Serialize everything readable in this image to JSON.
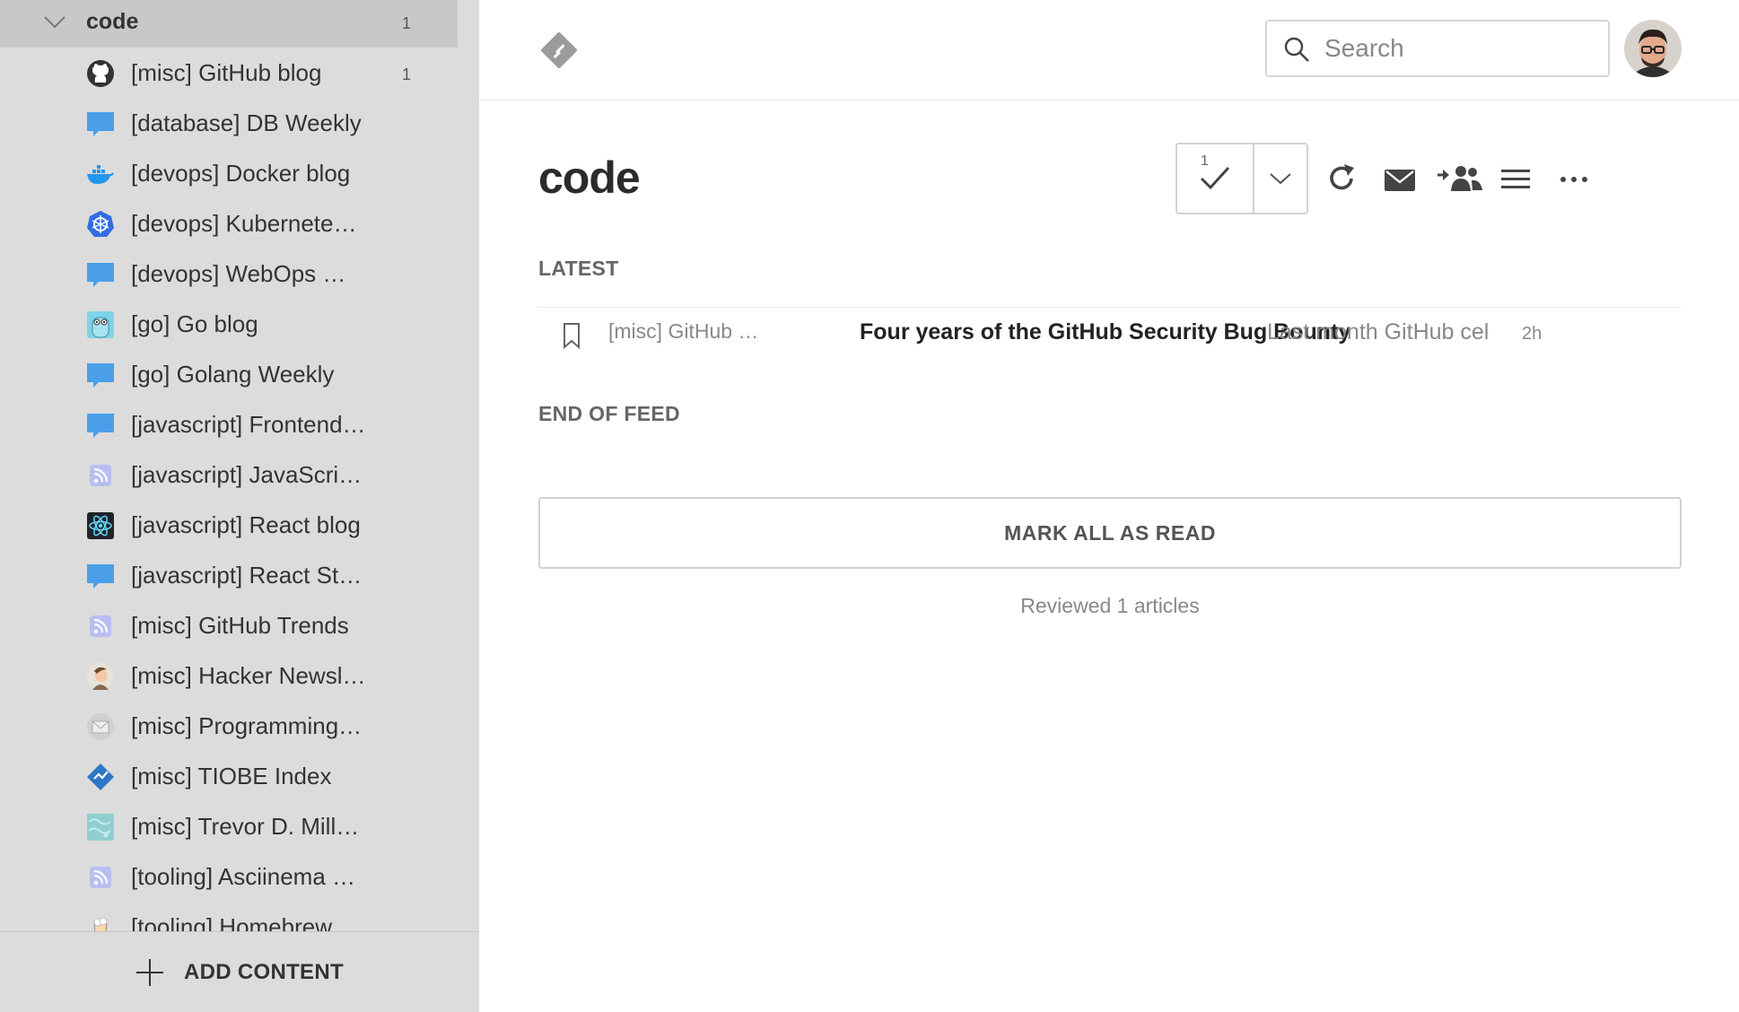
{
  "sidebar": {
    "group": {
      "name": "code",
      "count": "1"
    },
    "feeds": [
      {
        "label": "[misc] GitHub blog",
        "count": "1",
        "icon": "github-icon"
      },
      {
        "label": "[database] DB Weekly",
        "count": "",
        "icon": "chat-bubble-icon"
      },
      {
        "label": "[devops] Docker blog",
        "count": "",
        "icon": "docker-icon"
      },
      {
        "label": "[devops] Kubernete…",
        "count": "",
        "icon": "kubernetes-icon"
      },
      {
        "label": "[devops] WebOps …",
        "count": "",
        "icon": "chat-bubble-icon"
      },
      {
        "label": "[go] Go blog",
        "count": "",
        "icon": "gopher-icon"
      },
      {
        "label": "[go] Golang Weekly",
        "count": "",
        "icon": "chat-bubble-icon"
      },
      {
        "label": "[javascript] Frontend…",
        "count": "",
        "icon": "chat-bubble-icon"
      },
      {
        "label": "[javascript] JavaScri…",
        "count": "",
        "icon": "rss-icon"
      },
      {
        "label": "[javascript] React blog",
        "count": "",
        "icon": "react-icon"
      },
      {
        "label": "[javascript] React St…",
        "count": "",
        "icon": "chat-bubble-icon"
      },
      {
        "label": "[misc] GitHub Trends",
        "count": "",
        "icon": "rss-icon"
      },
      {
        "label": "[misc] Hacker Newsl…",
        "count": "",
        "icon": "hacker-newsletter-icon"
      },
      {
        "label": "[misc] Programming…",
        "count": "",
        "icon": "envelope-icon"
      },
      {
        "label": "[misc] TIOBE Index",
        "count": "",
        "icon": "tiobe-icon"
      },
      {
        "label": "[misc] Trevor D. Mill…",
        "count": "",
        "icon": "pattern-icon"
      },
      {
        "label": "[tooling] Asciinema …",
        "count": "",
        "icon": "rss-icon"
      },
      {
        "label": "[tooling] Homebrew",
        "count": "",
        "icon": "homebrew-icon"
      }
    ],
    "add_content_label": "ADD CONTENT"
  },
  "topbar": {
    "search_placeholder": "Search"
  },
  "main": {
    "title": "code",
    "mark_read_count": "1",
    "latest_label": "LATEST",
    "entries": [
      {
        "source": "[misc] GitHub …",
        "title": "Four years of the GitHub Security Bug Bounty",
        "summary": "Last month GitHub cel",
        "age": "2h"
      }
    ],
    "end_label": "END OF FEED",
    "mark_all_label": "MARK ALL AS READ",
    "reviewed_text": "Reviewed 1 articles"
  },
  "colors": {
    "sidebar_bg": "#dcdcdc",
    "sidebar_active": "#c8c8c8",
    "chat_icon_blue": "#4a9fe8",
    "rss_icon_purple": "#8e96e8",
    "text_dark": "#333333",
    "text_muted": "#888888"
  }
}
